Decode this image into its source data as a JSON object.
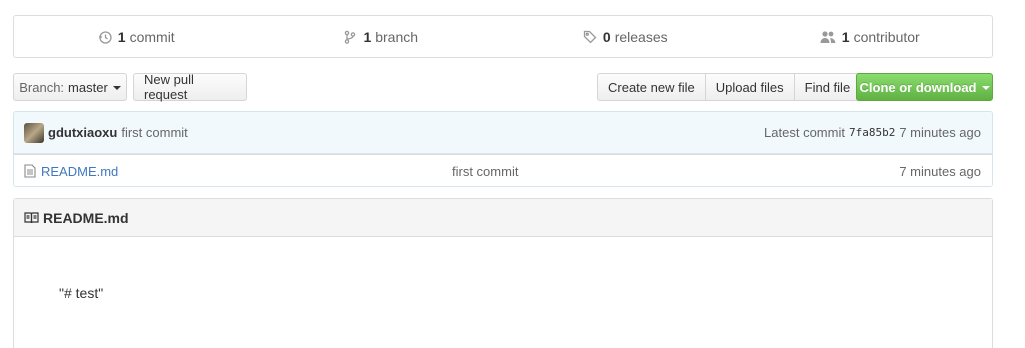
{
  "summary": {
    "commits": {
      "count": "1",
      "label": "commit",
      "icon": "history-icon"
    },
    "branches": {
      "count": "1",
      "label": "branch",
      "icon": "branch-icon"
    },
    "releases": {
      "count": "0",
      "label": "releases",
      "icon": "tag-icon"
    },
    "contributors": {
      "count": "1",
      "label": "contributor",
      "icon": "people-icon"
    }
  },
  "filenav": {
    "branch_prefix": "Branch:",
    "branch_name": "master",
    "new_pull_request": "New pull request",
    "create_new_file": "Create new file",
    "upload_files": "Upload files",
    "find_file": "Find file",
    "clone_or_download": "Clone or download"
  },
  "commit_tease": {
    "author": "gdutxiaoxu",
    "message": "first commit",
    "latest_label": "Latest commit",
    "sha": "7fa85b2",
    "age": "7 minutes ago"
  },
  "files": [
    {
      "name": "README.md",
      "message": "first commit",
      "age": "7 minutes ago",
      "icon": "file-icon"
    }
  ],
  "readme": {
    "title": "README.md",
    "icon": "book-icon",
    "content": "\"# test\""
  },
  "colors": {
    "accent_green": "#60b044",
    "link_blue": "#4078c0",
    "commit_bg": "#f2f9fc"
  }
}
